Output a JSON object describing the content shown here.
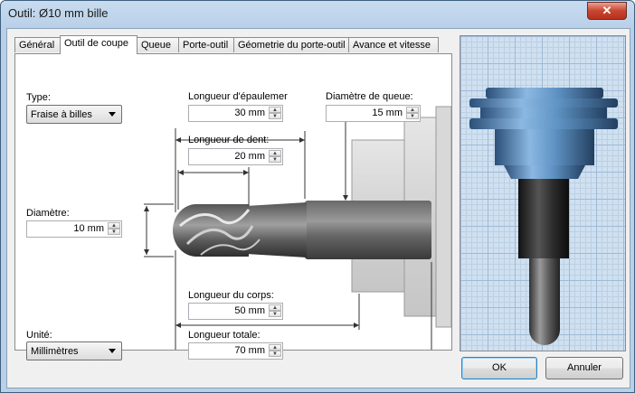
{
  "window": {
    "title": "Outil: Ø10 mm bille",
    "close_label": "✕"
  },
  "tabs": [
    {
      "label": "Général"
    },
    {
      "label": "Outil de coupe"
    },
    {
      "label": "Queue"
    },
    {
      "label": "Porte-outil"
    },
    {
      "label": "Géometrie du porte-outil"
    },
    {
      "label": "Avance et vitesse"
    }
  ],
  "active_tab": "Outil de coupe",
  "fields": {
    "type": {
      "label": "Type:",
      "value": "Fraise à billes"
    },
    "diametre": {
      "label": "Diamètre:",
      "value": "10 mm"
    },
    "unite": {
      "label": "Unité:",
      "value": "Millimètres"
    },
    "longueur_epaulement": {
      "label": "Longueur d'épaulemer",
      "value": "30 mm"
    },
    "longueur_dent": {
      "label": "Longueur de dent:",
      "value": "20 mm"
    },
    "diametre_queue": {
      "label": "Diamètre de queue:",
      "value": "15 mm"
    },
    "longueur_corps": {
      "label": "Longueur du corps:",
      "value": "50 mm"
    },
    "longueur_totale": {
      "label": "Longueur totale:",
      "value": "70 mm"
    }
  },
  "buttons": {
    "ok": "OK",
    "cancel": "Annuler"
  },
  "colors": {
    "title_bg": "#b9d0e8",
    "close_red": "#c8452f",
    "preview_grid": "#cfe0f0",
    "holder_blue": "#5f93c4"
  }
}
